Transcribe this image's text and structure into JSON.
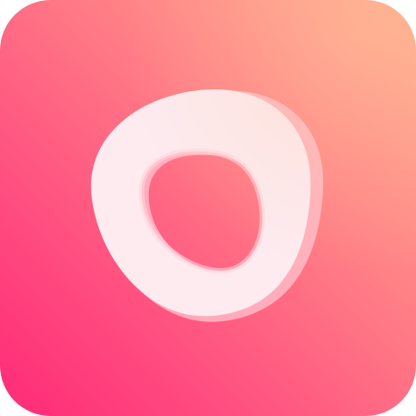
{
  "icon": {
    "name": "app-icon",
    "symbol": "rounded-triangle-ring-icon"
  },
  "colors": {
    "gradient_top_right": "#FFB08E",
    "gradient_mid": "#FF7F86",
    "gradient_bottom_left": "#FF2A77",
    "ring_fill": "#FDEBF0",
    "ring_shadow": "#FFC4CF"
  }
}
